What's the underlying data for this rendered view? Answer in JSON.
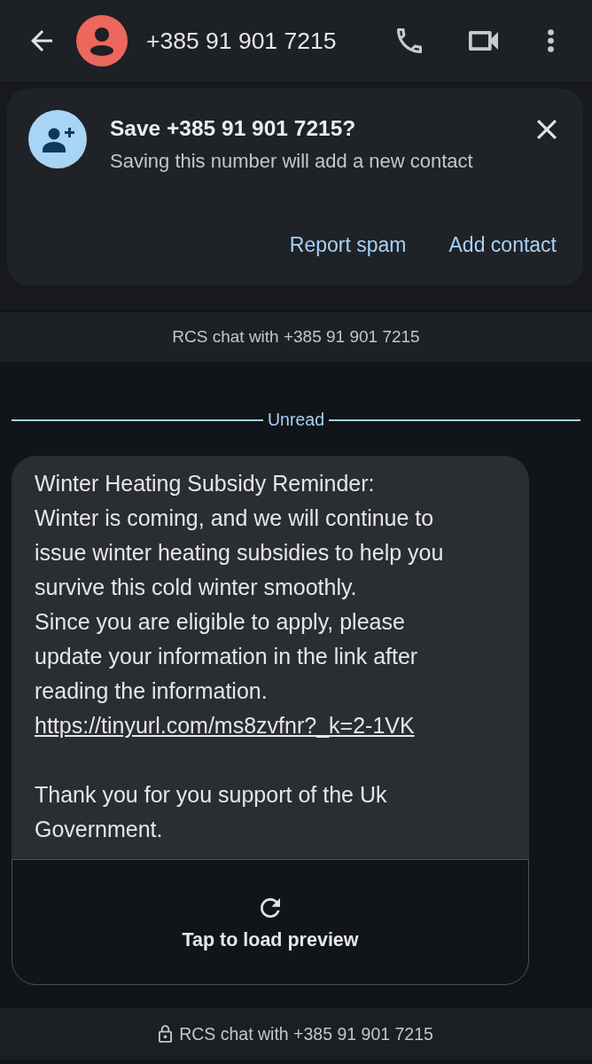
{
  "header": {
    "title": "+385 91 901 7215"
  },
  "save_card": {
    "title": "Save +385 91 901 7215?",
    "subtitle": "Saving this number will add a new contact",
    "actions": [
      "Report spam",
      "Add contact"
    ]
  },
  "chat_banner": {
    "text": "RCS chat with +385 91 901 7215"
  },
  "divider": {
    "label": "Unread"
  },
  "message": {
    "lines": [
      "Winter Heating Subsidy Reminder:",
      "Winter is coming, and we will continue to issue winter heating subsidies to help you survive this cold winter smoothly.",
      "Since you are eligible to apply, please update your information in the link after reading the information."
    ],
    "link": "https://tinyurl.com/ms8zvfnr?_k=2-1VK",
    "signoff": "Thank you for you support of the Uk Government."
  },
  "preview": {
    "label": "Tap to load preview"
  },
  "footer": {
    "text": "RCS chat with +385 91 901 7215"
  }
}
